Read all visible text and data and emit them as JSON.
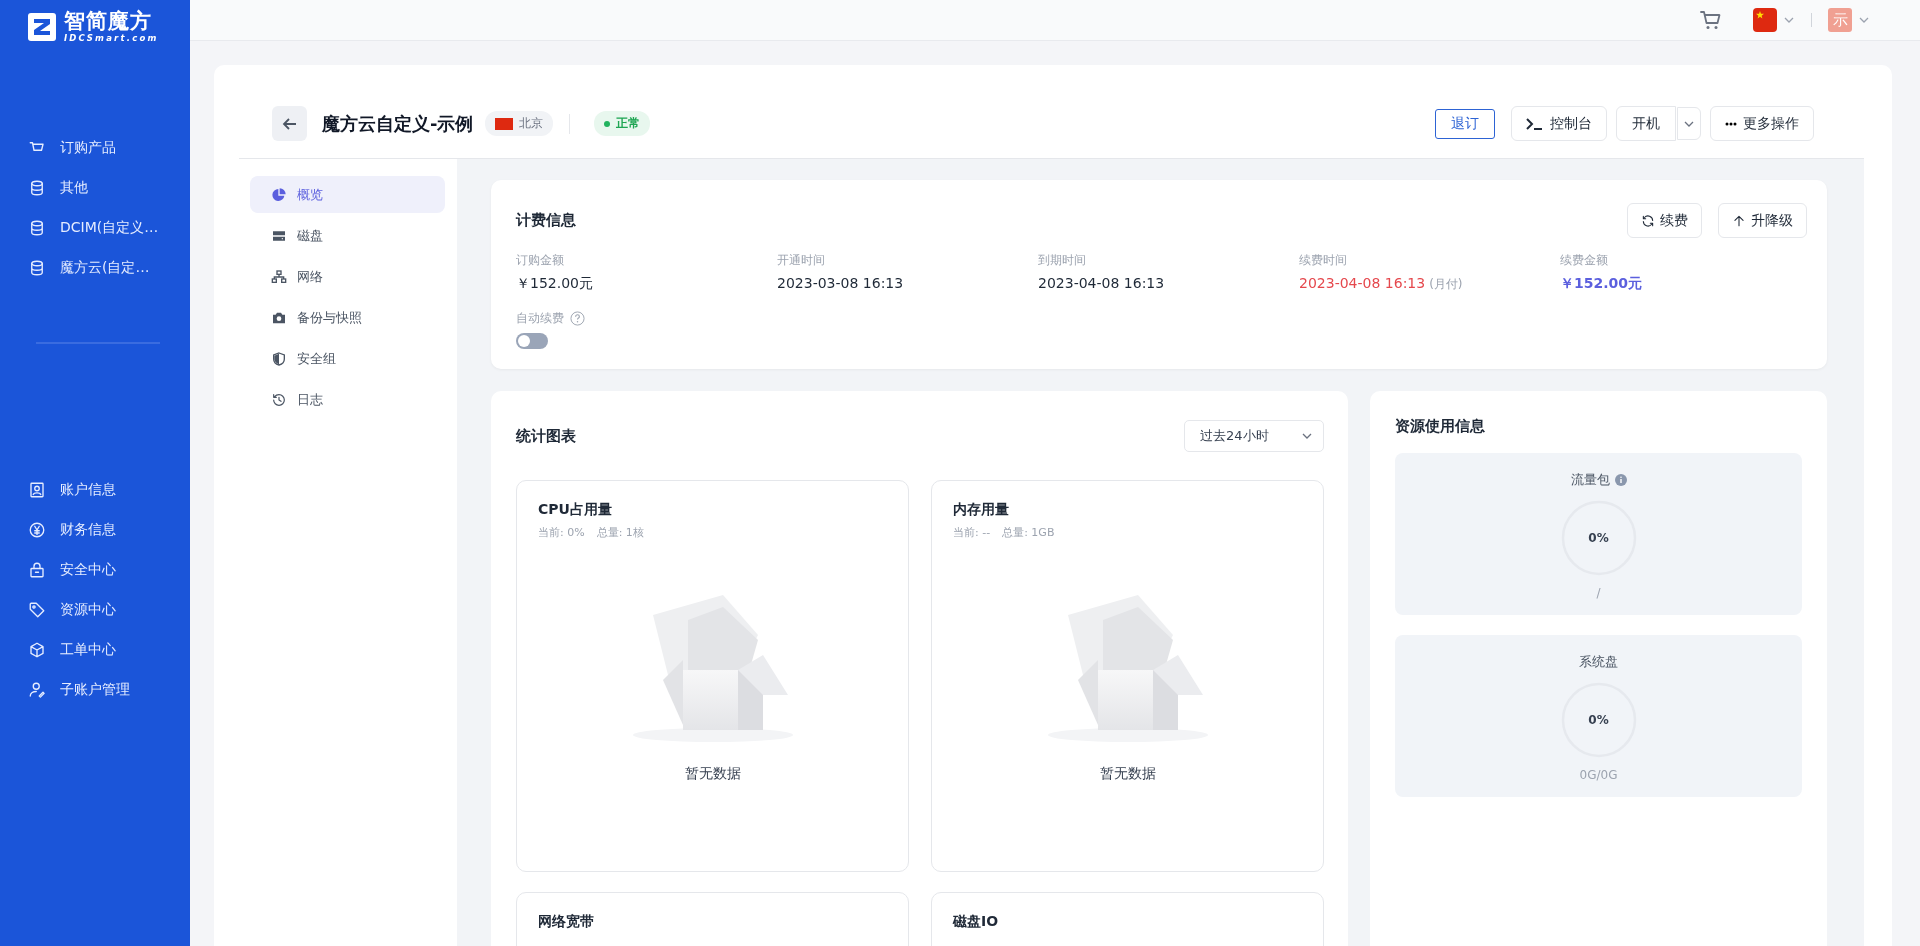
{
  "brand": {
    "name": "智简魔方",
    "domain": "IDCSmart.com"
  },
  "sidebar": {
    "top_items": [
      {
        "label": "订购产品"
      },
      {
        "label": "其他"
      },
      {
        "label": "DCIM(自定义…"
      },
      {
        "label": "魔方云(自定…"
      }
    ],
    "bottom_items": [
      {
        "label": "账户信息"
      },
      {
        "label": "财务信息"
      },
      {
        "label": "安全中心"
      },
      {
        "label": "资源中心"
      },
      {
        "label": "工单中心"
      },
      {
        "label": "子账户管理"
      }
    ]
  },
  "topbar": {
    "avatar": "示"
  },
  "header": {
    "title": "魔方云自定义-示例",
    "region": "北京",
    "status": {
      "label": "正常",
      "kind": "normal"
    },
    "actions": [
      {
        "label": "退订",
        "kind": "outline"
      },
      {
        "label": "控制台",
        "kind": "console"
      },
      {
        "label": "开机",
        "kind": "split"
      },
      {
        "label": "更多操作",
        "kind": "more"
      }
    ]
  },
  "subnav": [
    {
      "label": "概览",
      "selected": true
    },
    {
      "label": "磁盘",
      "selected": false
    },
    {
      "label": "网络",
      "selected": false
    },
    {
      "label": "备份与快照",
      "selected": false
    },
    {
      "label": "安全组",
      "selected": false
    },
    {
      "label": "日志",
      "selected": false
    }
  ],
  "billing": {
    "title": "计费信息",
    "buttons": [
      {
        "label": "续费"
      },
      {
        "label": "升降级"
      }
    ],
    "fields": [
      {
        "label": "订购金额",
        "value": "￥152.00元",
        "kind": "plain"
      },
      {
        "label": "开通时间",
        "value": "2023-03-08 16:13",
        "kind": "plain"
      },
      {
        "label": "到期时间",
        "value": "2023-04-08 16:13",
        "kind": "plain"
      },
      {
        "label": "续费时间",
        "value": "2023-04-08 16:13",
        "note": "(月付)",
        "kind": "warning"
      },
      {
        "label": "续费金额",
        "value": "￥152.00元",
        "kind": "accent"
      }
    ],
    "auto_renew": {
      "label": "自动续费",
      "on": false
    }
  },
  "stats": {
    "title": "统计图表",
    "range": "过去24小时",
    "charts": [
      {
        "title": "CPU占用量",
        "current": "当前: 0%",
        "total": "总量: 1核",
        "empty": "暂无数据"
      },
      {
        "title": "内存用量",
        "current": "当前: --",
        "total": "总量: 1GB",
        "empty": "暂无数据"
      },
      {
        "title": "网络宽带"
      },
      {
        "title": "磁盘IO"
      }
    ]
  },
  "resources": {
    "title": "资源使用信息",
    "items": [
      {
        "label": "流量包",
        "info": true,
        "level": 0,
        "reading": "0%",
        "detail": "/"
      },
      {
        "label": "系统盘",
        "info": false,
        "level": 0,
        "reading": "0%",
        "detail": "0G/0G"
      }
    ]
  }
}
